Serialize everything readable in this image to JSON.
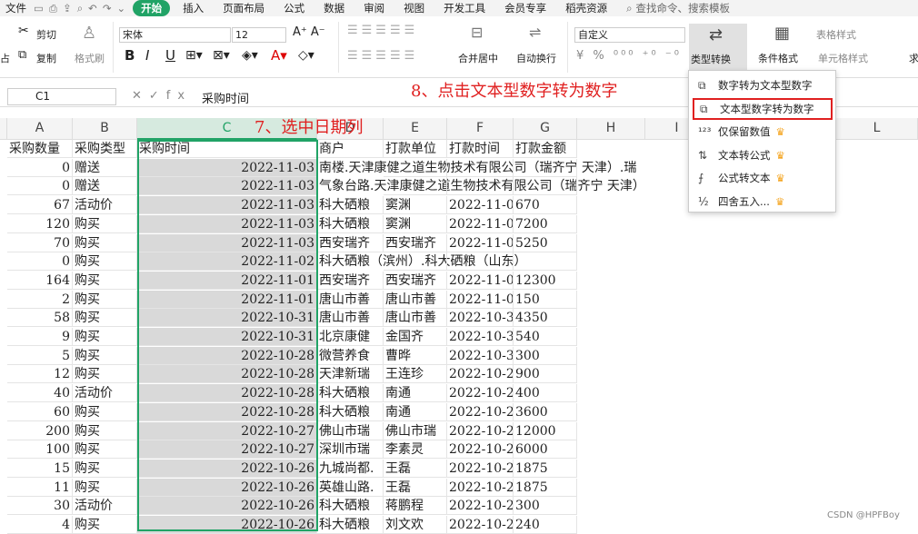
{
  "menu": {
    "file": "文件",
    "start": "开始",
    "insert": "插入",
    "layout": "页面布局",
    "formula": "公式",
    "data": "数据",
    "review": "审阅",
    "view": "视图",
    "dev": "开发工具",
    "member": "会员专享",
    "resources": "稻壳资源",
    "search": "查找命令、搜索模板"
  },
  "ribbon": {
    "cut": "剪切",
    "paste_frag": "占",
    "copy": "复制",
    "format_painter": "格式刷",
    "font": "宋体",
    "size": "12",
    "merge": "合并居中",
    "wrap": "自动换行",
    "numfmt": "自定义",
    "type_convert": "类型转换",
    "cond_format": "条件格式",
    "table_style": "表格样式",
    "cell_style": "单元格样式",
    "tail": "求"
  },
  "formula_bar": {
    "cell": "C1",
    "value": "采购时间"
  },
  "columns": [
    "A",
    "B",
    "C",
    "D",
    "E",
    "F",
    "G",
    "H",
    "I",
    "L"
  ],
  "headers": {
    "a": "采购数量",
    "b": "采购类型",
    "c": "采购时间",
    "d": "商户",
    "e": "打款单位",
    "f": "打款时间",
    "g": "打款金额"
  },
  "rows": [
    {
      "a": "0",
      "b": "赠送",
      "c": "2022-11-03",
      "d": "南楼.天津康健之道生物技术有限公司（瑞齐宁 天津）.瑞",
      "e": "",
      "f": "",
      "g": ""
    },
    {
      "a": "0",
      "b": "赠送",
      "c": "2022-11-03",
      "d": "气象台路.天津康健之道生物技术有限公司（瑞齐宁 天津）",
      "e": "",
      "f": "",
      "g": ""
    },
    {
      "a": "67",
      "b": "活动价",
      "c": "2022-11-03",
      "d": "科大硒粮",
      "e": "窦渊",
      "f": "2022-11-0",
      "g": "670"
    },
    {
      "a": "120",
      "b": "购买",
      "c": "2022-11-03",
      "d": "科大硒粮",
      "e": "窦渊",
      "f": "2022-11-0",
      "g": "7200"
    },
    {
      "a": "70",
      "b": "购买",
      "c": "2022-11-03",
      "d": "西安瑞齐",
      "e": "西安瑞齐",
      "f": "2022-11-0",
      "g": "5250"
    },
    {
      "a": "0",
      "b": "购买",
      "c": "2022-11-02",
      "d": "科大硒粮（滨州）.科大硒粮（山东）",
      "e": "",
      "f": "",
      "g": ""
    },
    {
      "a": "164",
      "b": "购买",
      "c": "2022-11-01",
      "d": "西安瑞齐",
      "e": "西安瑞齐",
      "f": "2022-11-0",
      "g": "12300"
    },
    {
      "a": "2",
      "b": "购买",
      "c": "2022-11-01",
      "d": "唐山市善",
      "e": "唐山市善",
      "f": "2022-11-0",
      "g": "150"
    },
    {
      "a": "58",
      "b": "购买",
      "c": "2022-10-31",
      "d": "唐山市善",
      "e": "唐山市善",
      "f": "2022-10-3",
      "g": "4350"
    },
    {
      "a": "9",
      "b": "购买",
      "c": "2022-10-31",
      "d": "北京康健",
      "e": "金国齐",
      "f": "2022-10-3",
      "g": "540"
    },
    {
      "a": "5",
      "b": "购买",
      "c": "2022-10-28",
      "d": "微营养食",
      "e": "曹晔",
      "f": "2022-10-3",
      "g": "300"
    },
    {
      "a": "12",
      "b": "购买",
      "c": "2022-10-28",
      "d": "天津新瑞",
      "e": "王连珍",
      "f": "2022-10-2",
      "g": "900"
    },
    {
      "a": "40",
      "b": "活动价",
      "c": "2022-10-28",
      "d": "科大硒粮",
      "e": "南通",
      "f": "2022-10-2",
      "g": "400"
    },
    {
      "a": "60",
      "b": "购买",
      "c": "2022-10-28",
      "d": "科大硒粮",
      "e": "南通",
      "f": "2022-10-2",
      "g": "3600"
    },
    {
      "a": "200",
      "b": "购买",
      "c": "2022-10-27",
      "d": "佛山市瑞",
      "e": "佛山市瑞",
      "f": "2022-10-2",
      "g": "12000"
    },
    {
      "a": "100",
      "b": "购买",
      "c": "2022-10-27",
      "d": "深圳市瑞",
      "e": "李素灵",
      "f": "2022-10-2",
      "g": "6000"
    },
    {
      "a": "15",
      "b": "购买",
      "c": "2022-10-26",
      "d": "九城尚都.",
      "e": "王磊",
      "f": "2022-10-2",
      "g": "1875"
    },
    {
      "a": "11",
      "b": "购买",
      "c": "2022-10-26",
      "d": "英雄山路.",
      "e": "王磊",
      "f": "2022-10-2",
      "g": "1875"
    },
    {
      "a": "30",
      "b": "活动价",
      "c": "2022-10-26",
      "d": "科大硒粮",
      "e": "蒋鹏程",
      "f": "2022-10-2",
      "g": "300"
    },
    {
      "a": "4",
      "b": "购买",
      "c": "2022-10-26",
      "d": "科大硒粮",
      "e": "刘文欢",
      "f": "2022-10-2",
      "g": "240"
    }
  ],
  "annotations": {
    "step7": "7、选中日期列",
    "step8": "8、点击文本型数字转为数字"
  },
  "dropdown": [
    {
      "icon": "number-to-text-icon",
      "label": "数字转为文本型数字",
      "crown": false
    },
    {
      "icon": "text-to-number-icon",
      "label": "文本型数字转为数字",
      "crown": false
    },
    {
      "icon": "keep-values-icon",
      "label": "仅保留数值",
      "crown": true
    },
    {
      "icon": "text-to-formula-icon",
      "label": "文本转公式",
      "crown": true
    },
    {
      "icon": "formula-to-text-icon",
      "label": "公式转文本",
      "crown": true
    },
    {
      "icon": "rounding-icon",
      "label": "四舍五入...",
      "crown": true
    }
  ],
  "watermark": "CSDN @HPFBoy"
}
